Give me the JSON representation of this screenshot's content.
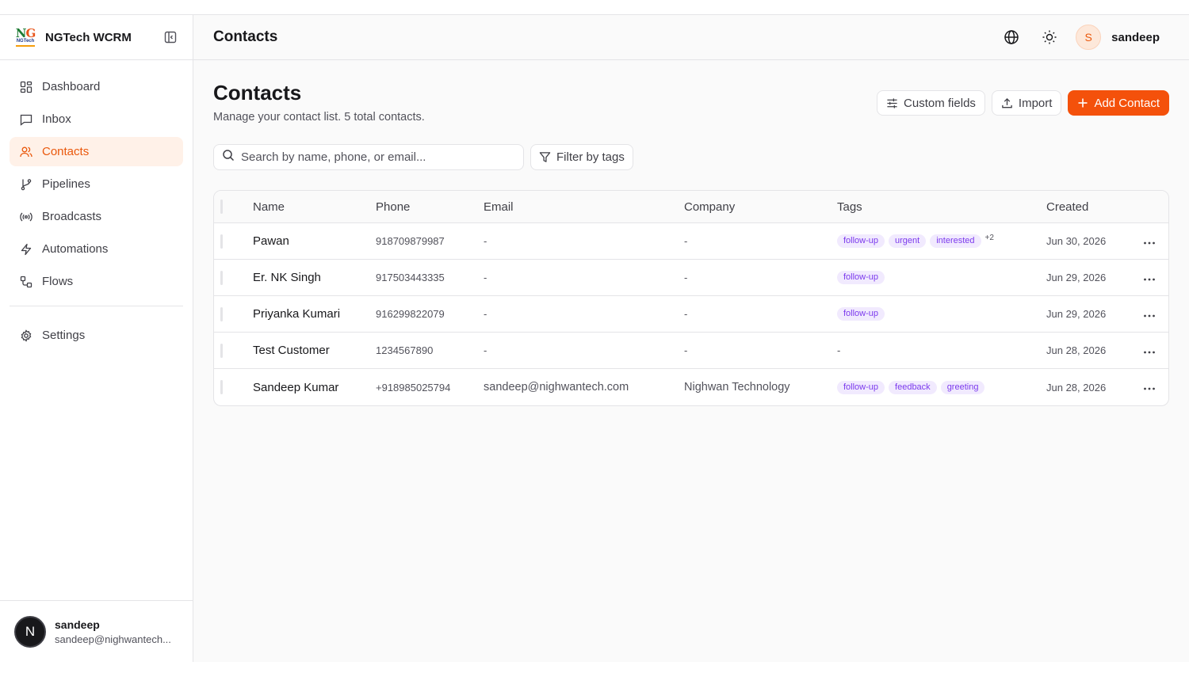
{
  "app": {
    "name": "NGTech WCRM",
    "logo_text_big": "NG",
    "logo_text_small": "NGTech"
  },
  "sidebar": {
    "items": [
      {
        "label": "Dashboard",
        "icon": "layout-dashboard-icon"
      },
      {
        "label": "Inbox",
        "icon": "message-square-icon"
      },
      {
        "label": "Contacts",
        "icon": "users-icon",
        "active": true
      },
      {
        "label": "Pipelines",
        "icon": "git-branch-icon"
      },
      {
        "label": "Broadcasts",
        "icon": "radio-icon"
      },
      {
        "label": "Automations",
        "icon": "zap-icon"
      },
      {
        "label": "Flows",
        "icon": "workflow-icon"
      }
    ],
    "settings_label": "Settings",
    "footer": {
      "avatar_letter": "N",
      "name": "sandeep",
      "email": "sandeep@nighwantech..."
    }
  },
  "topbar": {
    "title": "Contacts",
    "user_initial": "S",
    "user_name": "sandeep"
  },
  "page": {
    "title": "Contacts",
    "subtitle": "Manage your contact list. 5 total contacts.",
    "custom_fields_label": "Custom fields",
    "import_label": "Import",
    "add_contact_label": "Add Contact",
    "search_placeholder": "Search by name, phone, or email...",
    "filter_label": "Filter by tags"
  },
  "table": {
    "columns": [
      "Name",
      "Phone",
      "Email",
      "Company",
      "Tags",
      "Created"
    ],
    "rows": [
      {
        "name": "Pawan",
        "phone": "918709879987",
        "email": "-",
        "company": "-",
        "tags": [
          "follow-up",
          "urgent",
          "interested"
        ],
        "more": "+2",
        "created": "Jun 30, 2026"
      },
      {
        "name": "Er. NK Singh",
        "phone": "917503443335",
        "email": "-",
        "company": "-",
        "tags": [
          "follow-up"
        ],
        "more": "",
        "created": "Jun 29, 2026"
      },
      {
        "name": "Priyanka Kumari",
        "phone": "916299822079",
        "email": "-",
        "company": "-",
        "tags": [
          "follow-up"
        ],
        "more": "",
        "created": "Jun 29, 2026"
      },
      {
        "name": "Test Customer",
        "phone": "1234567890",
        "email": "-",
        "company": "-",
        "tags": [],
        "tags_empty": "-",
        "more": "",
        "created": "Jun 28, 2026"
      },
      {
        "name": "Sandeep Kumar",
        "phone": "+918985025794",
        "email": "sandeep@nighwantech.com",
        "company": "Nighwan Technology",
        "tags": [
          "follow-up",
          "feedback",
          "greeting"
        ],
        "more": "",
        "created": "Jun 28, 2026"
      }
    ]
  },
  "colors": {
    "accent": "#f4510b",
    "active_bg": "#fff1e8",
    "tag_text": "#7c3aed",
    "tag_bg": "#f1eafe"
  }
}
